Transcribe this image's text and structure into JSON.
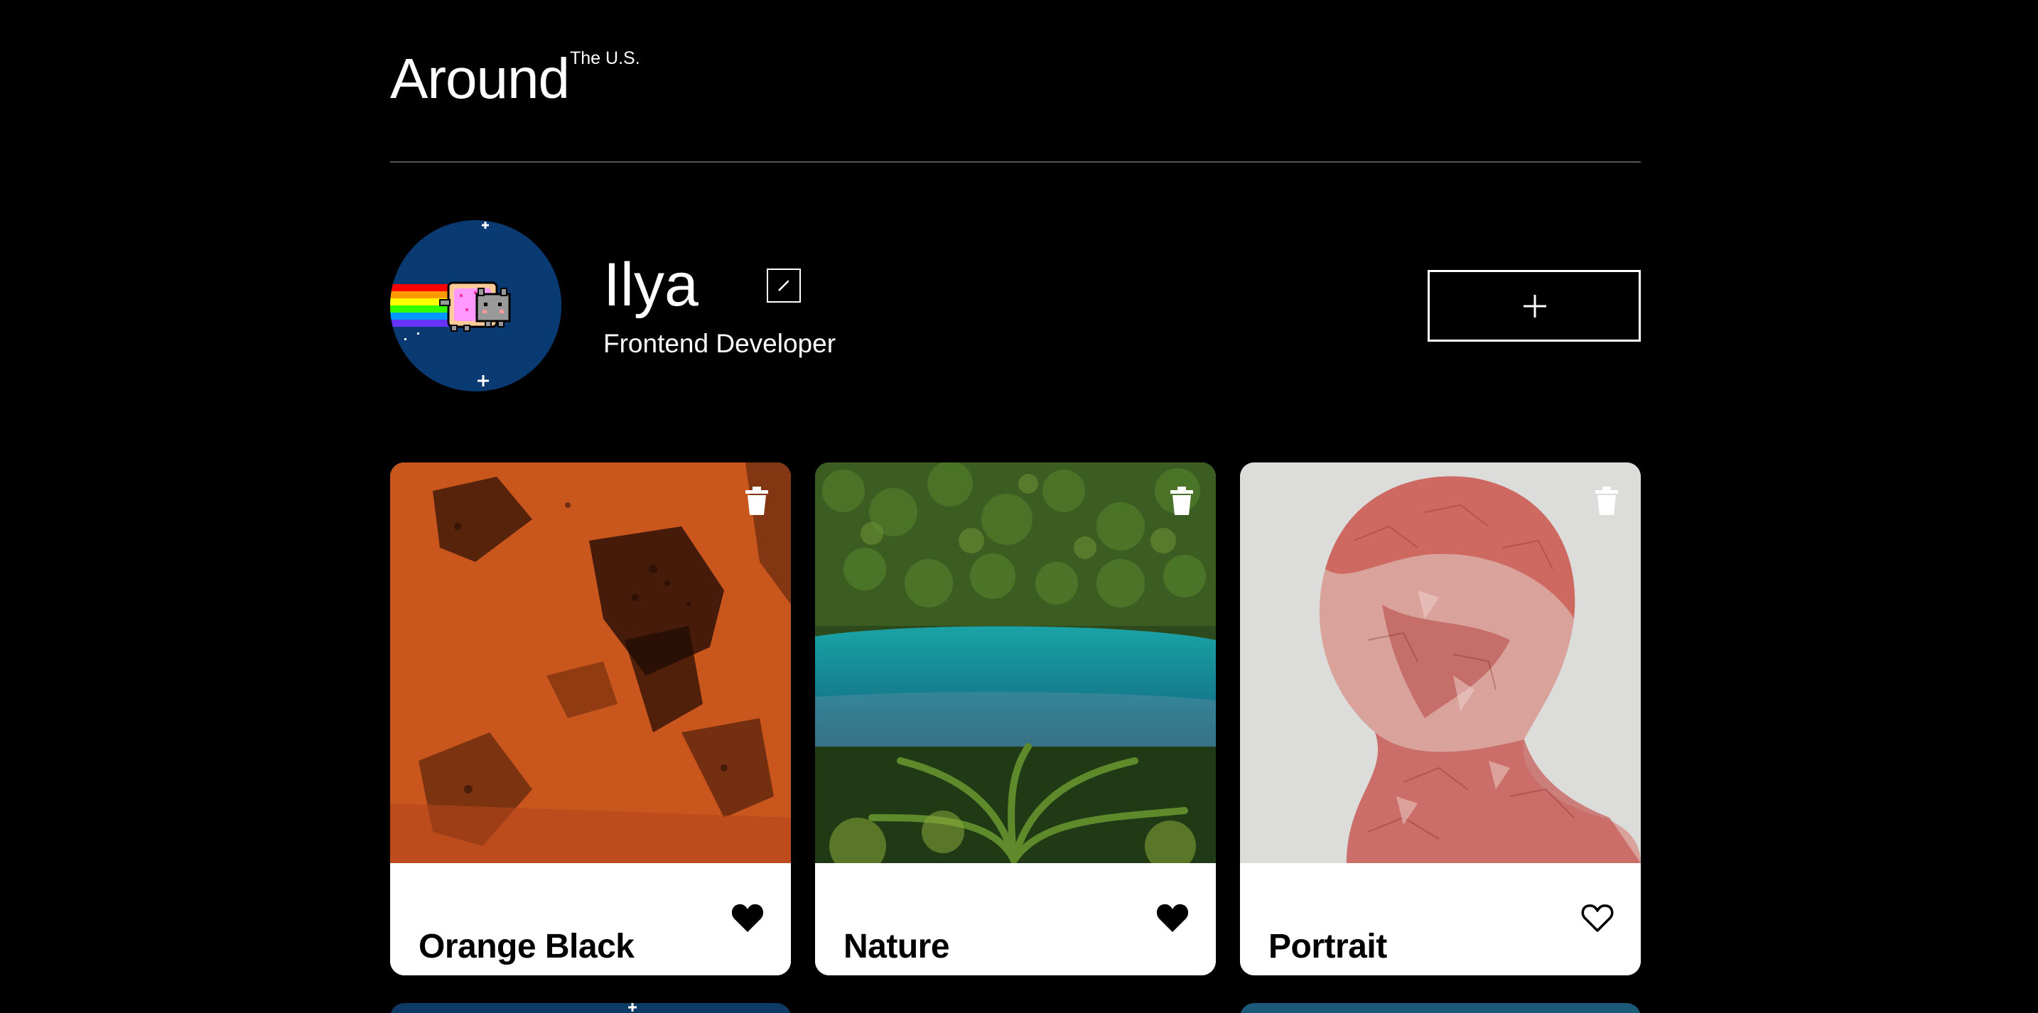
{
  "header": {
    "logo_main": "Around",
    "logo_sup": "The U.S."
  },
  "profile": {
    "name": "Ilya",
    "job": "Frontend Developer"
  },
  "cards": [
    {
      "title": "Orange Black",
      "liked": true
    },
    {
      "title": "Nature",
      "liked": true
    },
    {
      "title": "Portrait",
      "liked": false
    }
  ],
  "icons": {
    "edit": "pencil-icon",
    "add": "plus-icon",
    "delete": "trash-icon",
    "like": "heart-icon"
  },
  "colors": {
    "background": "#000000",
    "text": "#ffffff",
    "card_footer": "#ffffff",
    "divider": "#545454"
  }
}
